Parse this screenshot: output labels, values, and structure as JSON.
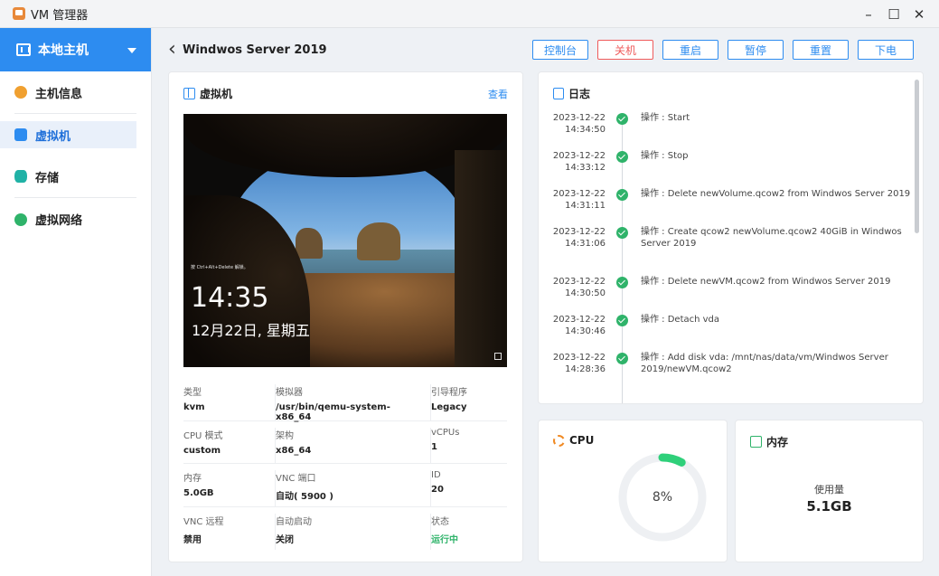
{
  "window": {
    "title": "VM 管理器",
    "controls": {
      "minimize": "–",
      "maximize": "☐",
      "close": "✕"
    }
  },
  "sidebar": {
    "host_select": "本地主机",
    "items": [
      {
        "label": "主机信息",
        "icon": "host-info-icon",
        "color": "#f0a030"
      },
      {
        "label": "虚拟机",
        "icon": "vm-icon",
        "color": "#2d8cf0"
      },
      {
        "label": "存储",
        "icon": "storage-icon",
        "color": "#20b2a6"
      },
      {
        "label": "虚拟网络",
        "icon": "network-icon",
        "color": "#2fb36a"
      }
    ]
  },
  "header": {
    "back": "‹",
    "title": "Windwos Server 2019",
    "actions": [
      "控制台",
      "关机",
      "重启",
      "暂停",
      "重置",
      "下电"
    ]
  },
  "vm_panel": {
    "title": "虚拟机",
    "link": "查看",
    "lockscreen": {
      "hint": "按 Ctrl+Alt+Delete 解锁。",
      "time": "14:35",
      "date": "12月22日, 星期五"
    },
    "rows": [
      [
        {
          "label": "类型",
          "value": "kvm"
        },
        {
          "label": "模拟器",
          "value": "/usr/bin/qemu-system-x86_64"
        },
        {
          "label": "引导程序",
          "value": "Legacy"
        }
      ],
      [
        {
          "label": "CPU 模式",
          "value": "custom"
        },
        {
          "label": "架构",
          "value": "x86_64"
        },
        {
          "label": "vCPUs",
          "value": "1"
        }
      ],
      [
        {
          "label": "内存",
          "value": "5.0GB"
        },
        {
          "label": "VNC 端口",
          "value": "自动( 5900 )"
        },
        {
          "label": "ID",
          "value": "20"
        }
      ],
      [
        {
          "label": "VNC 远程",
          "value": "禁用"
        },
        {
          "label": "自动启动",
          "value": "关闭"
        },
        {
          "label": "状态",
          "value": "运行中"
        }
      ]
    ]
  },
  "log_panel": {
    "title": "日志",
    "entries": [
      {
        "date": "2023-12-22",
        "time": "14:34:50",
        "text": "操作 : Start"
      },
      {
        "date": "2023-12-22",
        "time": "14:33:12",
        "text": "操作 : Stop"
      },
      {
        "date": "2023-12-22",
        "time": "14:31:11",
        "text": "操作 : Delete newVolume.qcow2 from Windwos Server 2019"
      },
      {
        "date": "2023-12-22",
        "time": "14:31:06",
        "text": "操作 : Create qcow2 newVolume.qcow2 40GiB in Windwos Server 2019"
      },
      {
        "date": "2023-12-22",
        "time": "14:30:50",
        "text": "操作 : Delete newVM.qcow2 from Windwos Server 2019"
      },
      {
        "date": "2023-12-22",
        "time": "14:30:46",
        "text": "操作 : Detach vda"
      },
      {
        "date": "2023-12-22",
        "time": "14:28:36",
        "text": "操作 : Add disk vda: /mnt/nas/data/vm/Windwos Server 2019/newVM.qcow2"
      }
    ]
  },
  "cpu_panel": {
    "title": "CPU",
    "usage_text": "8%",
    "usage_fraction": 0.08,
    "color": "#2fd07a"
  },
  "mem_panel": {
    "title": "内存",
    "label": "使用量",
    "value": "5.1GB"
  }
}
